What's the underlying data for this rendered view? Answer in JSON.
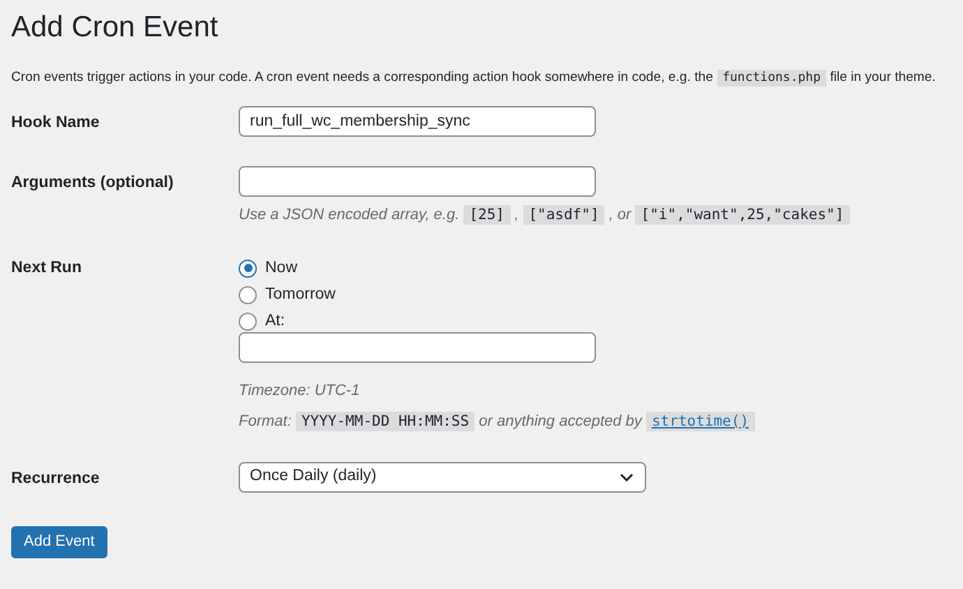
{
  "title": "Add Cron Event",
  "description": [
    {
      "kind": "text",
      "text": "Cron events trigger actions in your code. A cron event needs a corresponding action hook somewhere in code, e.g. the "
    },
    {
      "kind": "code",
      "text": "functions.php"
    },
    {
      "kind": "text",
      "text": " file in your theme."
    }
  ],
  "hook_name": {
    "label": "Hook Name",
    "value": "run_full_wc_membership_sync"
  },
  "arguments": {
    "label": "Arguments (optional)",
    "hint": [
      {
        "kind": "text",
        "text": "Use a JSON encoded array, e.g. "
      },
      {
        "kind": "code",
        "text": "[25]"
      },
      {
        "kind": "text",
        "text": " , "
      },
      {
        "kind": "code",
        "text": "[\"asdf\"]"
      },
      {
        "kind": "text",
        "text": " , or "
      },
      {
        "kind": "code",
        "text": "[\"i\",\"want\",25,\"cakes\"]"
      }
    ]
  },
  "next_run": {
    "label": "Next Run",
    "options": [
      {
        "label": "Now",
        "selected": true
      },
      {
        "label": "Tomorrow",
        "selected": false
      },
      {
        "label": "At:",
        "selected": false
      }
    ],
    "timezone": "Timezone: UTC-1",
    "format": [
      {
        "kind": "text",
        "text": "Format: "
      },
      {
        "kind": "code",
        "text": "YYYY-MM-DD HH:MM:SS"
      },
      {
        "kind": "text",
        "text": " or anything accepted by "
      },
      {
        "kind": "link",
        "text": "strtotime()"
      }
    ]
  },
  "recurrence": {
    "label": "Recurrence",
    "value": "Once Daily (daily)"
  },
  "submit": "Add Event"
}
